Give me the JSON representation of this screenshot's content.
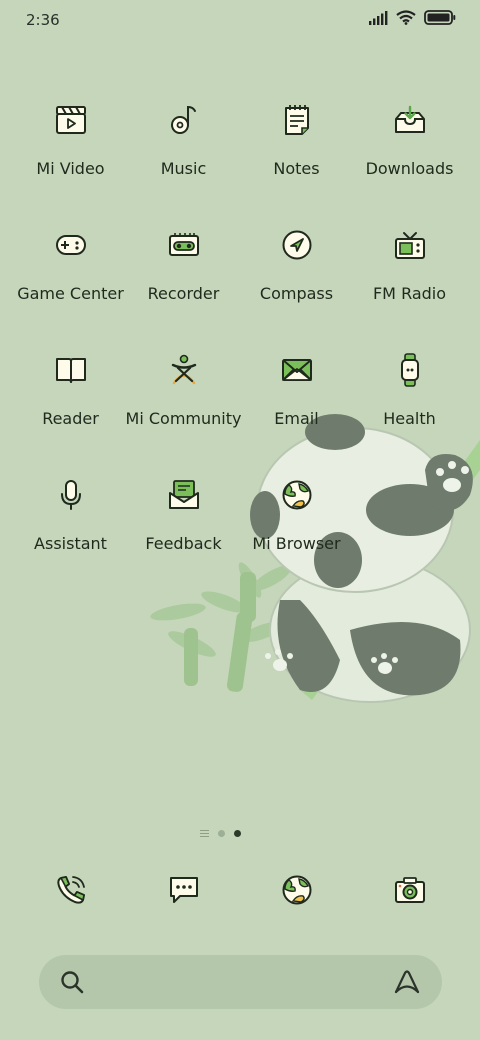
{
  "status_bar": {
    "time": "2:36"
  },
  "apps": [
    {
      "label": "Mi Video"
    },
    {
      "label": "Music"
    },
    {
      "label": "Notes"
    },
    {
      "label": "Downloads"
    },
    {
      "label": "Game Center"
    },
    {
      "label": "Recorder"
    },
    {
      "label": "Compass"
    },
    {
      "label": "FM Radio"
    },
    {
      "label": "Reader"
    },
    {
      "label": "Mi Community"
    },
    {
      "label": "Email"
    },
    {
      "label": "Health"
    },
    {
      "label": "Assistant"
    },
    {
      "label": "Feedback"
    },
    {
      "label": "Mi Browser"
    }
  ],
  "page_indicator": {
    "total": 2,
    "current": 2
  },
  "colors": {
    "background": "#c5d6bb",
    "accent": "#7bbf5a",
    "ink": "#1f2a1d"
  }
}
